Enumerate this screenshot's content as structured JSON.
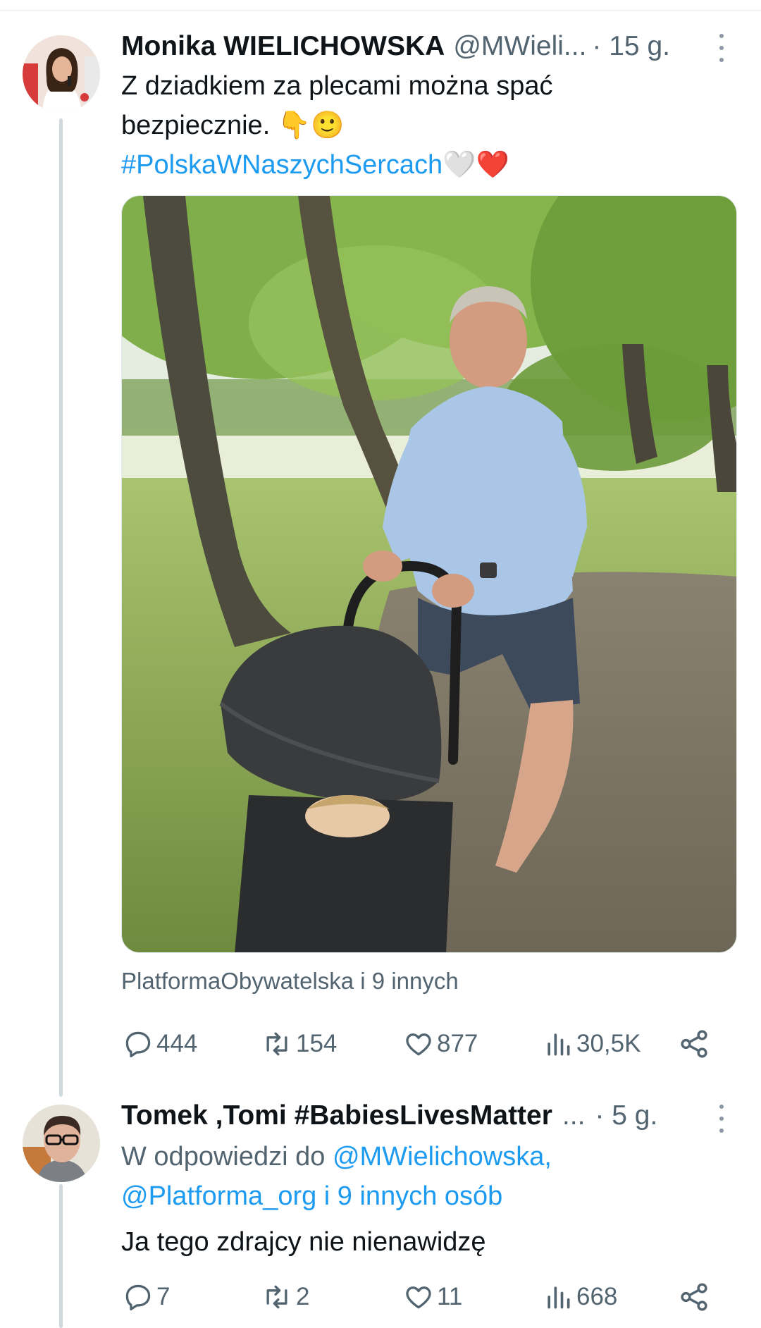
{
  "tweets": [
    {
      "author": {
        "name": "Monika WIELICHOWSKA",
        "handle": "@MWieli...",
        "time": "· 15 g."
      },
      "text": {
        "line1": "Z dziadkiem za plecami można spać",
        "line2": "bezpiecznie.",
        "line2_emoji": "👇🙂",
        "hashtag": "#PolskaWNaszychSercach",
        "hashtag_emoji": "🤍❤️"
      },
      "media": {
        "icon": "photo-man-pushing-stroller-under-trees"
      },
      "tagged": "PlatformaObywatelska i 9 innych",
      "stats": {
        "replies": "444",
        "reposts": "154",
        "likes": "877",
        "views": "30,5K"
      }
    },
    {
      "author": {
        "name": "Tomek ,Tomi #BabiesLivesMatter",
        "handle": "...",
        "time": "· 5 g."
      },
      "reply_to": {
        "prefix": "W odpowiedzi do",
        "mention1": "@MWielichowska,",
        "mention2": "@Platforma_org i 9 innych osób"
      },
      "text": "Ja tego zdrajcy nie nienawidzę",
      "stats": {
        "replies": "7",
        "reposts": "2",
        "likes": "11",
        "views": "668"
      }
    }
  ],
  "colors": {
    "accent": "#1d9bf0",
    "muted": "#536471",
    "text": "#0f1419",
    "thread_line": "#cfd9de"
  }
}
